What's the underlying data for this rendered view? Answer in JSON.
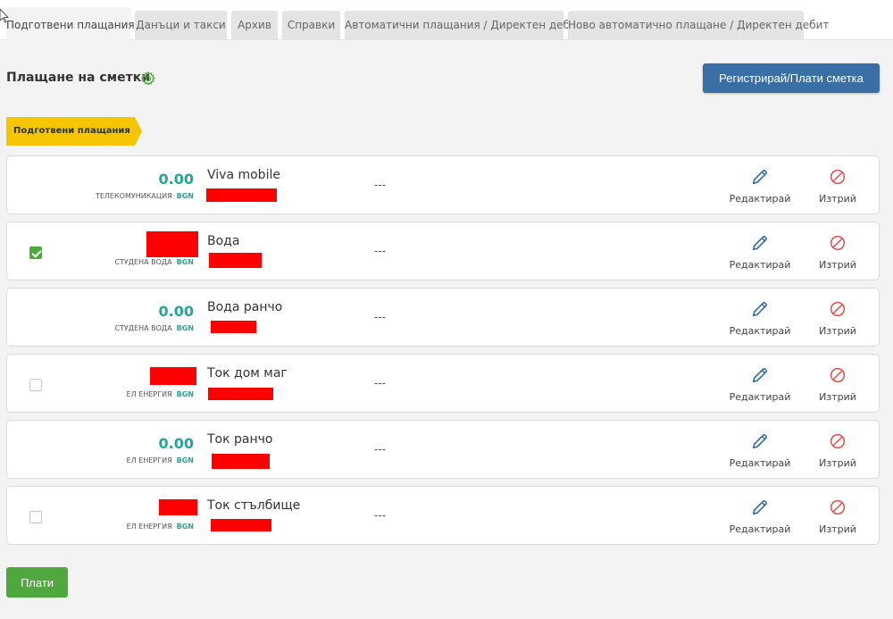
{
  "tabs": [
    {
      "label": "Подготвени плащания",
      "active": true
    },
    {
      "label": "Данъци и такси",
      "active": false
    },
    {
      "label": "Архив",
      "active": false
    },
    {
      "label": "Справки",
      "active": false
    },
    {
      "label": "Автоматични плащания / Директен дебит",
      "active": false
    },
    {
      "label": "Ново автоматично плащане / Директен дебит",
      "active": false
    }
  ],
  "header": {
    "title": "Плащане на сметки",
    "settings_icon": "gear-icon",
    "register_button": "Регистрирай/Плати сметка"
  },
  "section_tag": "Подготвени плащания",
  "rows": [
    {
      "amount": "0.00",
      "category": "ТЕЛЕКОМУНИКАЦИЯ",
      "currency": "BGN",
      "name": "Viva mobile",
      "details": "---",
      "checkbox": "none",
      "amount_redacted": false
    },
    {
      "amount": "",
      "category": "СТУДЕНА ВОДА",
      "currency": "BGN",
      "name": "Вода",
      "details": "---",
      "checkbox": "checked",
      "amount_redacted": true
    },
    {
      "amount": "0.00",
      "category": "СТУДЕНА ВОДА",
      "currency": "BGN",
      "name": "Вода ранчо",
      "details": "---",
      "checkbox": "none",
      "amount_redacted": false
    },
    {
      "amount": "",
      "category": "ЕЛ ЕНЕРГИЯ",
      "currency": "BGN",
      "name": "Ток дом маг",
      "details": "---",
      "checkbox": "unchecked",
      "amount_redacted": true
    },
    {
      "amount": "0.00",
      "category": "ЕЛ ЕНЕРГИЯ",
      "currency": "BGN",
      "name": "Ток ранчо",
      "details": "---",
      "checkbox": "none",
      "amount_redacted": false
    },
    {
      "amount": "",
      "category": "ЕЛ ЕНЕРГИЯ",
      "currency": "BGN",
      "name": "Ток стълбище",
      "details": "---",
      "checkbox": "unchecked",
      "amount_redacted": true
    }
  ],
  "row_actions": {
    "edit_label": "Редактирай",
    "edit_icon": "pencil-icon",
    "delete_label": "Изтрий",
    "delete_icon": "prohibited-icon"
  },
  "footer": {
    "pay_button": "Плати"
  },
  "colors": {
    "accent_teal": "#25a59a",
    "primary_blue": "#3a6fa5",
    "success_green": "#4fa83d",
    "tag_yellow": "#f5c500",
    "delete_red": "#e34a4a",
    "redaction": "#ff0000"
  }
}
